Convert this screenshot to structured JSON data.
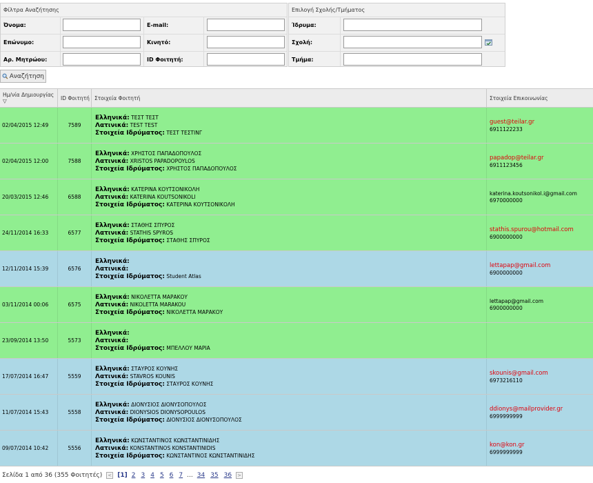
{
  "filters": {
    "title": "Φίλτρα Αναζήτησης",
    "first_name_label": "Όνομα:",
    "email_label": "E-mail:",
    "last_name_label": "Επώνυμο:",
    "mobile_label": "Κινητό:",
    "reg_number_label": "Αρ. Μητρώου:",
    "student_id_label": "ID Φοιτητή:"
  },
  "school_filter": {
    "title": "Επιλογή Σχολής/Τμήματος",
    "institution_label": "Ίδρυμα:",
    "school_label": "Σχολή:",
    "department_label": "Τμήμα:"
  },
  "search_button": {
    "label": "Αναζήτηση"
  },
  "table": {
    "headers": {
      "created": "Ημ/νία Δημιουργίας ▽",
      "id": "ID Φοιτητή",
      "details": "Στοιχεία Φοιτητή",
      "contact": "Στοιχεία Επικοινωνίας"
    },
    "field_labels": {
      "greek": "Ελληνικά:",
      "latin": "Λατινικά:",
      "institution": "Στοιχεία Ιδρύματος:"
    },
    "rows": [
      {
        "date": "02/04/2015 12:49",
        "id": "7589",
        "greek": "ΤΕΣΤ ΤΕΣΤ",
        "latin": "TEST TEST",
        "institution": "ΤΕΣΤ ΤΕΣΤΙΝΓ",
        "email": "guest@teilar.gr",
        "phone": "6911122233",
        "color": "#90ee90"
      },
      {
        "date": "02/04/2015 12:00",
        "id": "7588",
        "greek": "ΧΡΗΣΤΟΣ ΠΑΠΑΔΟΠΟΥΛΟΣ",
        "latin": "XRISTOS PAPADOPOYLOS",
        "institution": "ΧΡΗΣΤΟΣ ΠΑΠΑΔΟΠΟΥΛΟΣ",
        "email": "papadop@teilar.gr",
        "phone": "6911123456",
        "color": "#90ee90"
      },
      {
        "date": "20/03/2015 12:46",
        "id": "6588",
        "greek": "ΚΑΤΕΡΙΝΑ ΚΟΥΤΣΟΝΙΚΟΛΗ",
        "latin": "KATERINA KOUTSONIKOLI",
        "institution": "ΚΑΤΕΡΙΝΑ ΚΟΥΤΣΟΝΙΚΟΛΗ",
        "email": "katerina.koutsonikol.i@gmail.com",
        "phone": "6970000000",
        "color": "#90ee90"
      },
      {
        "date": "24/11/2014 16:33",
        "id": "6577",
        "greek": "ΣΤΑΘΗΣ ΣΠΥΡΟΣ",
        "latin": "STATHIS SPYROS",
        "institution": "ΣΤΑΘΗΣ ΣΠΥΡΟΣ",
        "email": "stathis.spurou@hotmail.com",
        "phone": "6900000000",
        "color": "#90ee90"
      },
      {
        "date": "12/11/2014 15:39",
        "id": "6576",
        "greek": "",
        "latin": "",
        "institution": "Student Atlas",
        "email": "lettapap@gmail.com",
        "phone": "6900000000",
        "color": "#add8e6"
      },
      {
        "date": "03/11/2014 00:06",
        "id": "6575",
        "greek": "ΝΙΚΟΛΕΤΤΑ ΜΑΡΑΚΟΥ",
        "latin": "NIKOLETTA MARAKOU",
        "institution": "ΝΙΚΟΛΕΤΤΑ ΜΑΡΑΚΟΥ",
        "email": "lettapap@gmail.com",
        "phone": "6900000000",
        "color": "#90ee90"
      },
      {
        "date": "23/09/2014 13:50",
        "id": "5573",
        "greek": "",
        "latin": "",
        "institution": "ΜΠΕΛΛΟΥ ΜΑΡΙΑ",
        "email": "",
        "phone": "",
        "color": "#90ee90"
      },
      {
        "date": "17/07/2014 16:47",
        "id": "5559",
        "greek": "ΣΤΑΥΡΟΣ ΚΟΥΝΗΣ",
        "latin": "STAVROS KOUNIS",
        "institution": "ΣΤΑΥΡΟΣ ΚΟΥΝΗΣ",
        "email": "skounis@gmail.com",
        "phone": "6973216110",
        "color": "#add8e6"
      },
      {
        "date": "11/07/2014 15:43",
        "id": "5558",
        "greek": "ΔΙΟΝΥΣΙΟΣ ΔΙΟΝΥΣΟΠΟΥΛΟΣ",
        "latin": "DIONYSIOS DIONYSOPOULOS",
        "institution": "ΔΙΟΝΥΣΙΟΣ ΔΙΟΝΥΣΟΠΟΥΛΟΣ",
        "email": "ddionys@mailprovider.gr",
        "phone": "6999999999",
        "color": "#add8e6"
      },
      {
        "date": "09/07/2014 10:42",
        "id": "5556",
        "greek": "ΚΩΝΣΤΑΝΤΙΝΟΣ ΚΩΝΣΤΑΝΤΙΝΙΔΗΣ",
        "latin": "KONSTANTINOS KONSTANTINIDIS",
        "institution": "ΚΩΝΣΤΑΝΤΙΝΟΣ ΚΩΝΣΤΑΝΤΙΝΙΔΗΣ",
        "email": "kon@kon.gr",
        "phone": "6999999999",
        "color": "#add8e6"
      }
    ]
  },
  "pager": {
    "summary": "Σελίδα 1 από 36 (355 Φοιτητές)",
    "prev": "<",
    "next": ">",
    "current": "[1]",
    "pages": [
      "2",
      "3",
      "4",
      "5",
      "6",
      "7"
    ],
    "ellipsis": "...",
    "last_pages": [
      "34",
      "35",
      "36"
    ]
  }
}
